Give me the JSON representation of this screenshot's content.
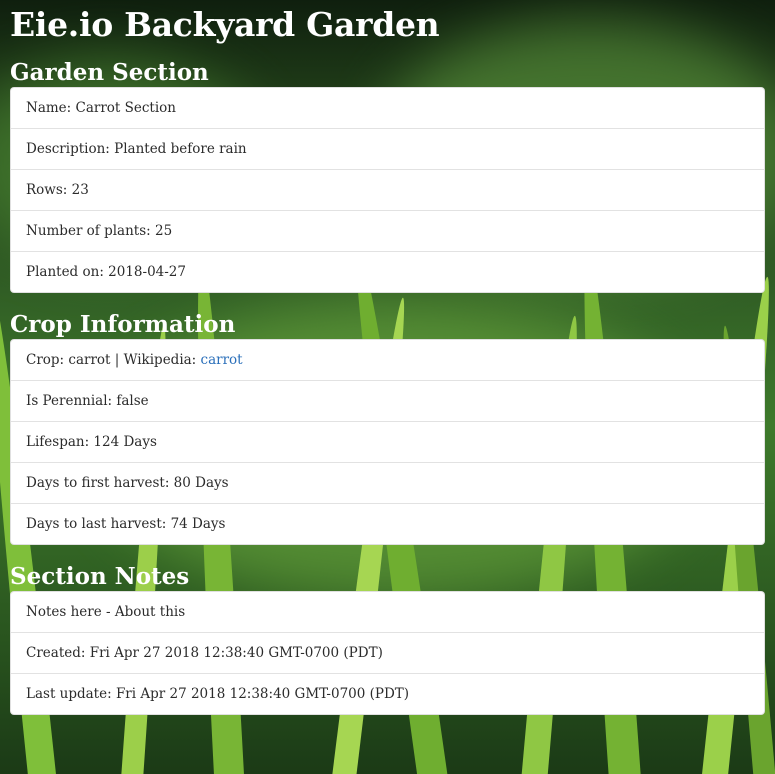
{
  "page": {
    "title": "Eie.io Backyard Garden"
  },
  "colors": {
    "link": "#2a6fba",
    "heading": "#ffffff",
    "panel": "#ffffff"
  },
  "garden_section": {
    "heading": "Garden Section",
    "name": "Name: Carrot Section",
    "description": "Description: Planted before rain",
    "rows": "Rows: 23",
    "plants": "Number of plants: 25",
    "planted_on": "Planted on: 2018-04-27"
  },
  "crop_info": {
    "heading": "Crop Information",
    "crop_prefix": "Crop: carrot | Wikipedia: ",
    "wiki_link": "carrot",
    "perennial": "Is Perennial: false",
    "lifespan": "Lifespan: 124 Days",
    "first_harvest": "Days to first harvest: 80 Days",
    "last_harvest": "Days to last harvest: 74 Days"
  },
  "section_notes": {
    "heading": "Section Notes",
    "notes": "Notes here - About this",
    "created": "Created: Fri Apr 27 2018 12:38:40 GMT-0700 (PDT)",
    "updated": "Last update: Fri Apr 27 2018 12:38:40 GMT-0700 (PDT)"
  }
}
